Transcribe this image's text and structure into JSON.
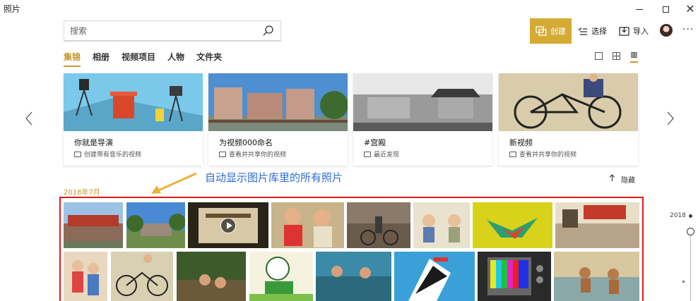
{
  "window": {
    "title": "照片"
  },
  "search": {
    "placeholder": "搜索"
  },
  "toolbar": {
    "create": "创建",
    "select": "选择",
    "import": "导入",
    "more": "···"
  },
  "tabs": [
    {
      "label": "集锦",
      "active": true
    },
    {
      "label": "相册"
    },
    {
      "label": "视频项目"
    },
    {
      "label": "人物"
    },
    {
      "label": "文件夹"
    }
  ],
  "cards": [
    {
      "title": "你就是导演",
      "subtitle": "创建带有音乐的视频"
    },
    {
      "title": "为视频000命名",
      "subtitle": "查看并共享你的视频"
    },
    {
      "title": "#宫殿",
      "subtitle": "最近发现"
    },
    {
      "title": "新视频",
      "subtitle": "查看并共享你的视频"
    }
  ],
  "annotation": "自动显示图片库里的所有照片",
  "hide_label": "隐藏",
  "month_label": "2018年7月",
  "timeline": {
    "year": "2018"
  },
  "colors": {
    "accent": "#d5ab34",
    "annotation": "#2c6bd6",
    "frame": "#e21b1b"
  }
}
